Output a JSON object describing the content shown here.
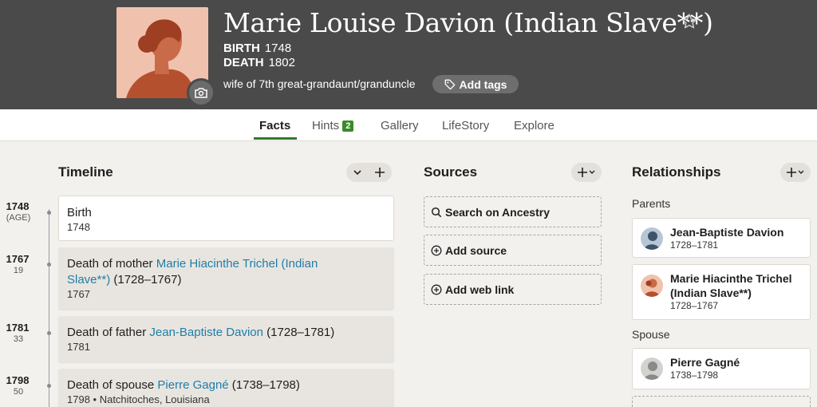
{
  "person": {
    "name": "Marie Louise Davion (Indian Slave**)",
    "birth_label": "BIRTH",
    "birth_year": "1748",
    "death_label": "DEATH",
    "death_year": "1802",
    "relationship": "wife of 7th great-grandaunt/granduncle",
    "add_tags_label": "Add tags"
  },
  "tabs": {
    "facts": "Facts",
    "hints": "Hints",
    "hints_count": "2",
    "gallery": "Gallery",
    "lifestory": "LifeStory",
    "explore": "Explore"
  },
  "timeline": {
    "title": "Timeline",
    "events": [
      {
        "year": "1748",
        "age": "(AGE)",
        "title": "Birth",
        "detail": "1748"
      },
      {
        "year": "1767",
        "age": "19",
        "prefix": "Death of mother ",
        "link": "Marie Hiacinthe Trichel (Indian Slave**)",
        "suffix": " (1728–1767)",
        "detail": "1767"
      },
      {
        "year": "1781",
        "age": "33",
        "prefix": "Death of father ",
        "link": "Jean-Baptiste Davion",
        "suffix": " (1728–1781)",
        "detail": "1781"
      },
      {
        "year": "1798",
        "age": "50",
        "prefix": "Death of spouse ",
        "link": "Pierre Gagné",
        "suffix": " (1738–1798)",
        "detail": "1798 • Natchitoches, Louisiana"
      }
    ]
  },
  "sources": {
    "title": "Sources",
    "search": "Search on Ancestry",
    "add_source": "Add source",
    "add_web_link": "Add web link"
  },
  "relationships": {
    "title": "Relationships",
    "parents_label": "Parents",
    "spouse_label": "Spouse",
    "parents": [
      {
        "name": "Jean-Baptiste Davion",
        "dates": "1728–1781"
      },
      {
        "name": "Marie Hiacinthe Trichel (Indian Slave**)",
        "dates": "1728–1767"
      }
    ],
    "spouse": [
      {
        "name": "Pierre Gagné",
        "dates": "1738–1798"
      }
    ]
  },
  "colors": {
    "header_bg": "#4a4a4a",
    "link": "#1f7ea8",
    "active_tab": "#2d7a2d",
    "hint_badge": "#3a8a2a"
  }
}
